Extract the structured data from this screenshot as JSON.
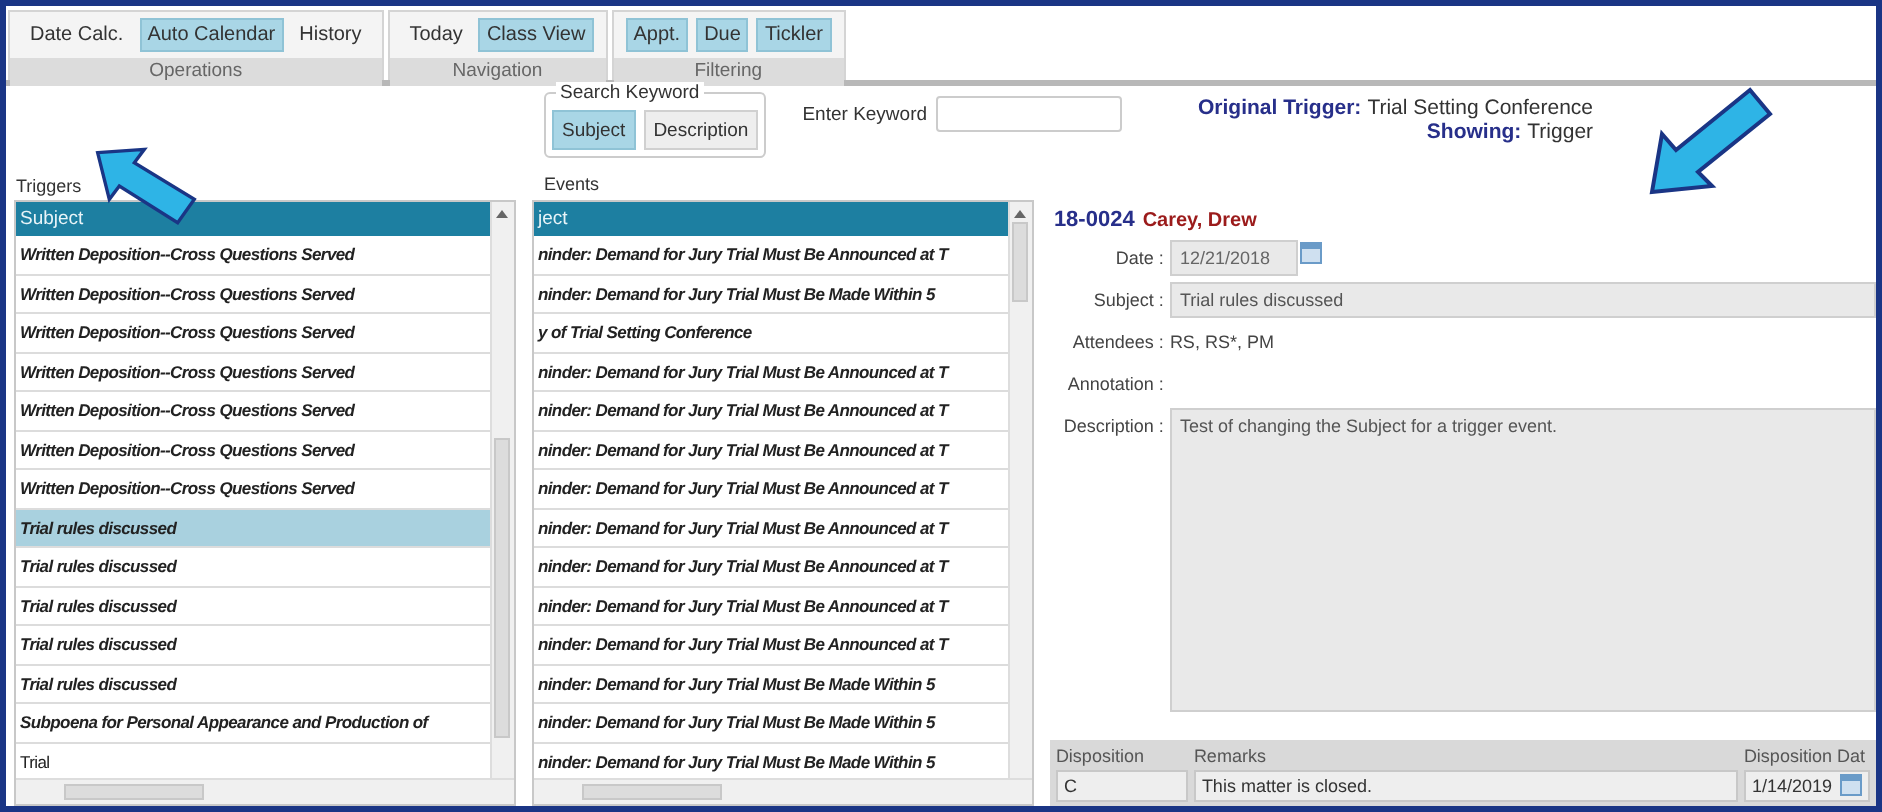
{
  "toolbar": {
    "groups": [
      {
        "label": "Operations",
        "buttons": [
          {
            "label": "Date Calc.",
            "selected": false
          },
          {
            "label": "Auto Calendar",
            "selected": true
          },
          {
            "label": "History",
            "selected": false
          }
        ]
      },
      {
        "label": "Navigation",
        "buttons": [
          {
            "label": "Today",
            "selected": false
          },
          {
            "label": "Class View",
            "selected": true
          }
        ]
      },
      {
        "label": "Filtering",
        "buttons": [
          {
            "label": "Appt.",
            "selected": true
          },
          {
            "label": "Due",
            "selected": true
          },
          {
            "label": "Tickler",
            "selected": true
          }
        ]
      }
    ]
  },
  "search": {
    "group_label": "Search Keyword",
    "options": [
      {
        "label": "Subject",
        "selected": true
      },
      {
        "label": "Description",
        "selected": false
      }
    ],
    "keyword_label": "Enter Keyword"
  },
  "info": [
    {
      "label": "Original Trigger:",
      "value": "Trial Setting Conference"
    },
    {
      "label": "Showing:",
      "value": "Trigger"
    }
  ],
  "triggers": {
    "title": "Triggers",
    "column": "Subject",
    "rows": [
      {
        "text": "Written Deposition--Cross Questions Served",
        "bold": true,
        "selected": false
      },
      {
        "text": "Written Deposition--Cross Questions Served",
        "bold": true,
        "selected": false
      },
      {
        "text": "Written Deposition--Cross Questions Served",
        "bold": true,
        "selected": false
      },
      {
        "text": "Written Deposition--Cross Questions Served",
        "bold": true,
        "selected": false
      },
      {
        "text": "Written Deposition--Cross Questions Served",
        "bold": true,
        "selected": false
      },
      {
        "text": "Written Deposition--Cross Questions Served",
        "bold": true,
        "selected": false
      },
      {
        "text": "Written Deposition--Cross Questions Served",
        "bold": true,
        "selected": false
      },
      {
        "text": "Trial rules discussed",
        "bold": true,
        "selected": true
      },
      {
        "text": "Trial rules discussed",
        "bold": true,
        "selected": false
      },
      {
        "text": "Trial rules discussed",
        "bold": true,
        "selected": false
      },
      {
        "text": "Trial rules discussed",
        "bold": true,
        "selected": false
      },
      {
        "text": "Trial rules discussed",
        "bold": true,
        "selected": false
      },
      {
        "text": "Subpoena for Personal Appearance and Production of",
        "bold": true,
        "selected": false
      },
      {
        "text": "Trial",
        "bold": false,
        "selected": false
      }
    ]
  },
  "events": {
    "title": "Events",
    "column": "ject",
    "rows": [
      {
        "text": "ninder: Demand for Jury Trial Must Be Announced at T",
        "bold": true,
        "selected": false
      },
      {
        "text": "ninder: Demand for Jury Trial Must Be Made Within 5",
        "bold": true,
        "selected": false
      },
      {
        "text": "y of Trial Setting Conference",
        "bold": true,
        "selected": false
      },
      {
        "text": "ninder: Demand for Jury Trial Must Be Announced at T",
        "bold": true,
        "selected": false
      },
      {
        "text": "ninder: Demand for Jury Trial Must Be Announced at T",
        "bold": true,
        "selected": false
      },
      {
        "text": "ninder: Demand for Jury Trial Must Be Announced at T",
        "bold": true,
        "selected": false
      },
      {
        "text": "ninder: Demand for Jury Trial Must Be Announced at T",
        "bold": true,
        "selected": false
      },
      {
        "text": "ninder: Demand for Jury Trial Must Be Announced at T",
        "bold": true,
        "selected": false
      },
      {
        "text": "ninder: Demand for Jury Trial Must Be Announced at T",
        "bold": true,
        "selected": false
      },
      {
        "text": "ninder: Demand for Jury Trial Must Be Announced at T",
        "bold": true,
        "selected": false
      },
      {
        "text": "ninder: Demand for Jury Trial Must Be Announced at T",
        "bold": true,
        "selected": false
      },
      {
        "text": "ninder: Demand for Jury Trial Must Be Made Within 5",
        "bold": true,
        "selected": false
      },
      {
        "text": "ninder: Demand for Jury Trial Must Be Made Within 5",
        "bold": true,
        "selected": false
      },
      {
        "text": "ninder: Demand for Jury Trial Must Be Made Within 5",
        "bold": true,
        "selected": false
      }
    ]
  },
  "detail": {
    "case_number": "18-0024",
    "client": "Carey, Drew",
    "fields": [
      {
        "kind": "date",
        "label": "Date :",
        "value": "12/21/2018"
      },
      {
        "kind": "input",
        "label": "Subject :",
        "value": "Trial rules discussed"
      },
      {
        "kind": "text",
        "label": "Attendees :",
        "value": "RS, RS*, PM"
      },
      {
        "kind": "text",
        "label": "Annotation :"
      },
      {
        "kind": "textarea",
        "label": "Description :",
        "value": "Test of changing the Subject for a trigger event."
      }
    ],
    "disposition": {
      "columns": [
        "Disposition",
        "Remarks",
        "Disposition Dat"
      ],
      "values": [
        "C",
        "This matter is closed.",
        "1/14/2019"
      ]
    }
  }
}
